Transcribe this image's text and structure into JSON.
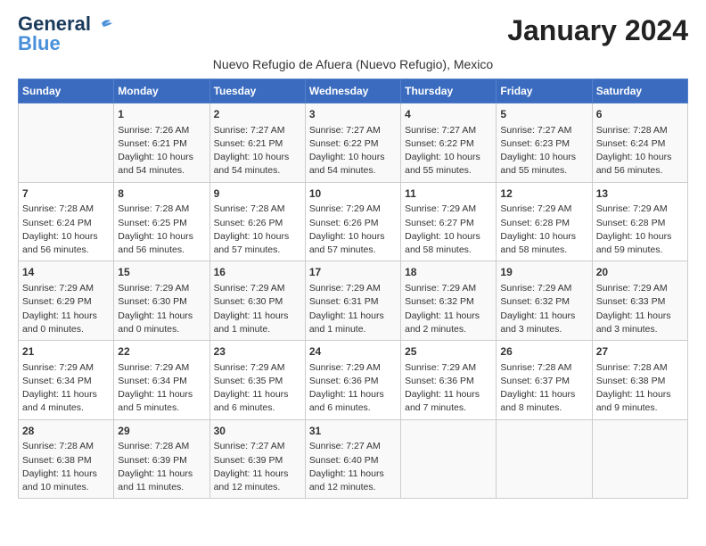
{
  "logo": {
    "line1": "General",
    "line2": "Blue"
  },
  "title": "January 2024",
  "subtitle": "Nuevo Refugio de Afuera (Nuevo Refugio), Mexico",
  "weekdays": [
    "Sunday",
    "Monday",
    "Tuesday",
    "Wednesday",
    "Thursday",
    "Friday",
    "Saturday"
  ],
  "weeks": [
    [
      {
        "day": "",
        "info": ""
      },
      {
        "day": "1",
        "info": "Sunrise: 7:26 AM\nSunset: 6:21 PM\nDaylight: 10 hours\nand 54 minutes."
      },
      {
        "day": "2",
        "info": "Sunrise: 7:27 AM\nSunset: 6:21 PM\nDaylight: 10 hours\nand 54 minutes."
      },
      {
        "day": "3",
        "info": "Sunrise: 7:27 AM\nSunset: 6:22 PM\nDaylight: 10 hours\nand 54 minutes."
      },
      {
        "day": "4",
        "info": "Sunrise: 7:27 AM\nSunset: 6:22 PM\nDaylight: 10 hours\nand 55 minutes."
      },
      {
        "day": "5",
        "info": "Sunrise: 7:27 AM\nSunset: 6:23 PM\nDaylight: 10 hours\nand 55 minutes."
      },
      {
        "day": "6",
        "info": "Sunrise: 7:28 AM\nSunset: 6:24 PM\nDaylight: 10 hours\nand 56 minutes."
      }
    ],
    [
      {
        "day": "7",
        "info": "Sunrise: 7:28 AM\nSunset: 6:24 PM\nDaylight: 10 hours\nand 56 minutes."
      },
      {
        "day": "8",
        "info": "Sunrise: 7:28 AM\nSunset: 6:25 PM\nDaylight: 10 hours\nand 56 minutes."
      },
      {
        "day": "9",
        "info": "Sunrise: 7:28 AM\nSunset: 6:26 PM\nDaylight: 10 hours\nand 57 minutes."
      },
      {
        "day": "10",
        "info": "Sunrise: 7:29 AM\nSunset: 6:26 PM\nDaylight: 10 hours\nand 57 minutes."
      },
      {
        "day": "11",
        "info": "Sunrise: 7:29 AM\nSunset: 6:27 PM\nDaylight: 10 hours\nand 58 minutes."
      },
      {
        "day": "12",
        "info": "Sunrise: 7:29 AM\nSunset: 6:28 PM\nDaylight: 10 hours\nand 58 minutes."
      },
      {
        "day": "13",
        "info": "Sunrise: 7:29 AM\nSunset: 6:28 PM\nDaylight: 10 hours\nand 59 minutes."
      }
    ],
    [
      {
        "day": "14",
        "info": "Sunrise: 7:29 AM\nSunset: 6:29 PM\nDaylight: 11 hours\nand 0 minutes."
      },
      {
        "day": "15",
        "info": "Sunrise: 7:29 AM\nSunset: 6:30 PM\nDaylight: 11 hours\nand 0 minutes."
      },
      {
        "day": "16",
        "info": "Sunrise: 7:29 AM\nSunset: 6:30 PM\nDaylight: 11 hours\nand 1 minute."
      },
      {
        "day": "17",
        "info": "Sunrise: 7:29 AM\nSunset: 6:31 PM\nDaylight: 11 hours\nand 1 minute."
      },
      {
        "day": "18",
        "info": "Sunrise: 7:29 AM\nSunset: 6:32 PM\nDaylight: 11 hours\nand 2 minutes."
      },
      {
        "day": "19",
        "info": "Sunrise: 7:29 AM\nSunset: 6:32 PM\nDaylight: 11 hours\nand 3 minutes."
      },
      {
        "day": "20",
        "info": "Sunrise: 7:29 AM\nSunset: 6:33 PM\nDaylight: 11 hours\nand 3 minutes."
      }
    ],
    [
      {
        "day": "21",
        "info": "Sunrise: 7:29 AM\nSunset: 6:34 PM\nDaylight: 11 hours\nand 4 minutes."
      },
      {
        "day": "22",
        "info": "Sunrise: 7:29 AM\nSunset: 6:34 PM\nDaylight: 11 hours\nand 5 minutes."
      },
      {
        "day": "23",
        "info": "Sunrise: 7:29 AM\nSunset: 6:35 PM\nDaylight: 11 hours\nand 6 minutes."
      },
      {
        "day": "24",
        "info": "Sunrise: 7:29 AM\nSunset: 6:36 PM\nDaylight: 11 hours\nand 6 minutes."
      },
      {
        "day": "25",
        "info": "Sunrise: 7:29 AM\nSunset: 6:36 PM\nDaylight: 11 hours\nand 7 minutes."
      },
      {
        "day": "26",
        "info": "Sunrise: 7:28 AM\nSunset: 6:37 PM\nDaylight: 11 hours\nand 8 minutes."
      },
      {
        "day": "27",
        "info": "Sunrise: 7:28 AM\nSunset: 6:38 PM\nDaylight: 11 hours\nand 9 minutes."
      }
    ],
    [
      {
        "day": "28",
        "info": "Sunrise: 7:28 AM\nSunset: 6:38 PM\nDaylight: 11 hours\nand 10 minutes."
      },
      {
        "day": "29",
        "info": "Sunrise: 7:28 AM\nSunset: 6:39 PM\nDaylight: 11 hours\nand 11 minutes."
      },
      {
        "day": "30",
        "info": "Sunrise: 7:27 AM\nSunset: 6:39 PM\nDaylight: 11 hours\nand 12 minutes."
      },
      {
        "day": "31",
        "info": "Sunrise: 7:27 AM\nSunset: 6:40 PM\nDaylight: 11 hours\nand 12 minutes."
      },
      {
        "day": "",
        "info": ""
      },
      {
        "day": "",
        "info": ""
      },
      {
        "day": "",
        "info": ""
      }
    ]
  ]
}
